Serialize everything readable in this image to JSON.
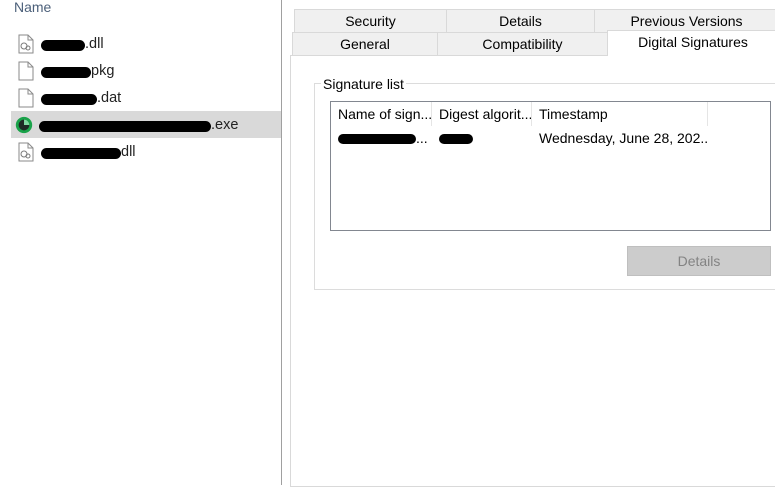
{
  "explorer": {
    "column_header": "Name",
    "files": [
      {
        "name_visible": ".dll",
        "icon": "dll-file-icon",
        "selected": false
      },
      {
        "name_visible": "pkg",
        "icon": "blank-file-icon",
        "selected": false
      },
      {
        "name_visible": ".dat",
        "icon": "blank-file-icon",
        "selected": false
      },
      {
        "name_visible": ".exe",
        "icon": "green-app-icon",
        "selected": true
      },
      {
        "name_visible": "dll",
        "icon": "dll-file-icon",
        "selected": false
      }
    ]
  },
  "dialog": {
    "tabs_row1": [
      "Security",
      "Details",
      "Previous Versions"
    ],
    "tabs_row2": [
      "General",
      "Compatibility",
      "Digital Signatures"
    ],
    "active_tab": "Digital Signatures",
    "group_label": "Signature list",
    "columns": [
      "Name of sign...",
      "Digest algorit...",
      "Timestamp"
    ],
    "rows": [
      {
        "name": "...",
        "digest": "",
        "timestamp": "Wednesday, June 28, 202..."
      }
    ],
    "details_button": "Details"
  },
  "colors": {
    "selection": "#d9d9d9",
    "header_text": "#4c607a",
    "disabled_button_bg": "#cccccc",
    "disabled_button_text": "#838383"
  }
}
